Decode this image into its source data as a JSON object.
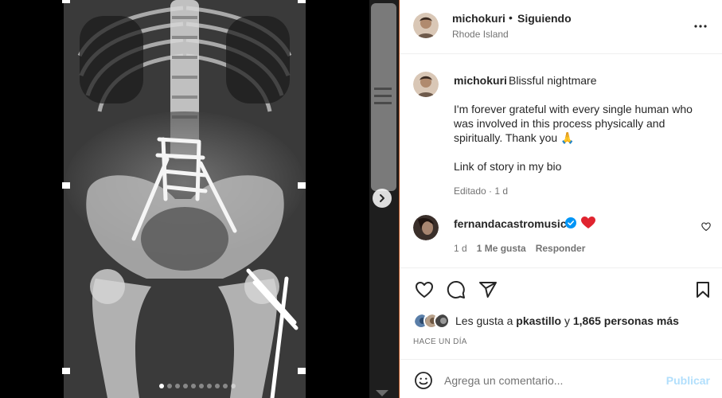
{
  "header": {
    "username": "michokuri",
    "separator": "•",
    "follow_status": "Siguiendo",
    "location": "Rhode Island",
    "more_icon": "more-horizontal-icon"
  },
  "caption": {
    "username": "michokuri",
    "title": "Blissful nightmare",
    "body": "I'm forever grateful with every single human who was involved in this process physically and spiritually. Thank you 🙏",
    "link_line": "Link of story in my bio",
    "meta": "Editado · 1 d"
  },
  "comment": {
    "username": "fernandacastromusica",
    "time": "1 d",
    "likes": "1 Me gusta",
    "reply": "Responder"
  },
  "actions": {
    "icons": [
      "heart-icon",
      "comment-icon",
      "share-icon",
      "bookmark-icon"
    ],
    "likes_prefix": "Les gusta a",
    "likes_user": "pkastillo",
    "likes_mid": "y",
    "likes_count": "1,865 personas más",
    "time_ago": "HACE UN DÍA"
  },
  "composer": {
    "placeholder": "Agrega un comentario...",
    "post_label": "Publicar"
  },
  "carousel": {
    "dot_count": 10,
    "active_index": 0
  },
  "colors": {
    "verified": "#0095f6",
    "heart": "#ed4956",
    "post_disabled": "#b2dffc"
  }
}
